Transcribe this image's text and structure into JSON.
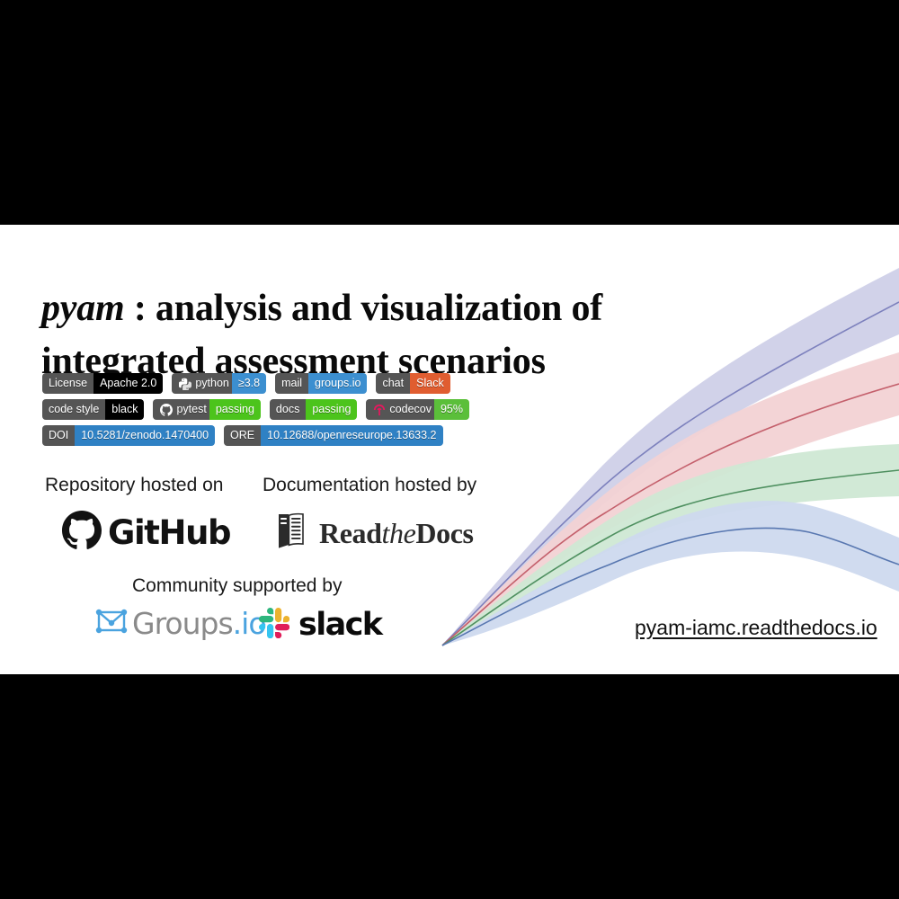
{
  "title": {
    "emphasis": "pyam",
    "rest": " : analysis and visualization of integrated assessment scenarios"
  },
  "badges": {
    "rows": [
      [
        {
          "name": "license",
          "left": "License",
          "right": "Apache 2.0",
          "right_color": "#000000",
          "icon": null
        },
        {
          "name": "python-version",
          "left": "python",
          "right": "≥3.8",
          "right_color": "#3c8fd0",
          "icon": "python-icon"
        },
        {
          "name": "mail",
          "left": "mail",
          "right": "groups.io",
          "right_color": "#3c8fd0",
          "icon": null
        },
        {
          "name": "chat",
          "left": "chat",
          "right": "Slack",
          "right_color": "#e05d30",
          "icon": null
        }
      ],
      [
        {
          "name": "code-style",
          "left": "code style",
          "right": "black",
          "right_color": "#000000",
          "icon": null
        },
        {
          "name": "pytest",
          "left": "pytest",
          "right": "passing",
          "right_color": "#4cc41c",
          "icon": "github-icon"
        },
        {
          "name": "docs",
          "left": "docs",
          "right": "passing",
          "right_color": "#4cc41c",
          "icon": null
        },
        {
          "name": "codecov",
          "left": "codecov",
          "right": "95%",
          "right_color": "#5bbf3a",
          "icon": "codecov-icon"
        }
      ],
      [
        {
          "name": "doi",
          "left": "DOI",
          "right": "10.5281/zenodo.1470400",
          "right_color": "#2f81c4",
          "icon": null
        },
        {
          "name": "ore",
          "left": "ORE",
          "right": "10.12688/openreseurope.13633.2",
          "right_color": "#2f81c4",
          "icon": null
        }
      ]
    ]
  },
  "hosting": {
    "repository_label": "Repository hosted on",
    "repository_logo_text": "GitHub",
    "documentation_label": "Documentation hosted by",
    "documentation_logo_text_1": "Read",
    "documentation_logo_text_the": "the",
    "documentation_logo_text_2": "Docs"
  },
  "community": {
    "label": "Community supported by",
    "groups_text": "Groups",
    "groups_suffix": ".io",
    "slack_text": "slack"
  },
  "site_url": "pyam-iamc.readthedocs.io",
  "colors": {
    "badge_grey": "#555555",
    "badge_black": "#000000",
    "badge_blue": "#3c8fd0",
    "badge_green": "#4cc41c",
    "badge_orange": "#e05d30",
    "doi_blue": "#2f81c4",
    "card_background": "#ffffff",
    "page_background": "#000000",
    "groups_blue": "#4aa3df",
    "groups_grey": "#8a8a8a",
    "codecov_pink": "#e5195e",
    "slack_blue": "#36c5f0",
    "slack_green": "#2eb67d",
    "slack_red": "#e01e5a",
    "slack_yellow": "#ecb22e"
  },
  "chart_data": {
    "type": "area",
    "title": "",
    "xlabel": "",
    "ylabel": "",
    "grid": false,
    "legend": "none",
    "description": "Four fan charts (median line with shaded uncertainty band) diverging from a common origin point on the left and spreading toward the right.",
    "x": [
      0,
      0.1,
      0.2,
      0.3,
      0.4,
      0.5,
      0.6,
      0.7,
      0.8,
      0.9,
      1.0
    ],
    "series": [
      {
        "name": "scenario-purple",
        "color": "#8b8fc4",
        "band_color": "#cfd0e8",
        "median": [
          0,
          18,
          36,
          52,
          65,
          75,
          83,
          89,
          94,
          98,
          101
        ],
        "lower": [
          0,
          14,
          29,
          43,
          55,
          64,
          71,
          77,
          82,
          86,
          89
        ],
        "upper": [
          0,
          22,
          44,
          62,
          76,
          87,
          96,
          103,
          108,
          112,
          115
        ]
      },
      {
        "name": "scenario-red",
        "color": "#c9606a",
        "band_color": "#f0cfd0",
        "median": [
          0,
          14,
          28,
          40,
          50,
          57,
          63,
          67,
          70,
          72,
          74
        ],
        "lower": [
          0,
          11,
          22,
          32,
          40,
          46,
          51,
          54,
          57,
          58,
          60
        ],
        "upper": [
          0,
          17,
          34,
          49,
          61,
          69,
          75,
          80,
          84,
          87,
          89
        ]
      },
      {
        "name": "scenario-green",
        "color": "#4f9060",
        "band_color": "#cfe8d4",
        "median": [
          0,
          11,
          22,
          31,
          38,
          43,
          46,
          47,
          47,
          47,
          47
        ],
        "lower": [
          0,
          9,
          17,
          25,
          30,
          34,
          36,
          37,
          37,
          37,
          37
        ],
        "upper": [
          0,
          14,
          27,
          38,
          46,
          52,
          55,
          57,
          57,
          57,
          57
        ]
      },
      {
        "name": "scenario-blue",
        "color": "#5877b0",
        "band_color": "#cdd9ee",
        "median": [
          0,
          9,
          18,
          25,
          30,
          32,
          32,
          30,
          27,
          24,
          22
        ],
        "lower": [
          0,
          7,
          14,
          19,
          23,
          25,
          25,
          23,
          20,
          16,
          13
        ],
        "upper": [
          0,
          11,
          22,
          31,
          37,
          40,
          40,
          38,
          35,
          32,
          31
        ]
      }
    ]
  }
}
